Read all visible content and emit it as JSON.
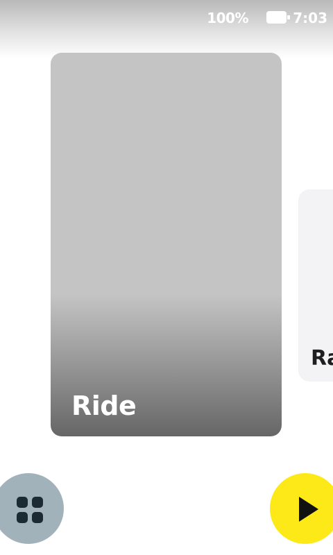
{
  "status_bar": {
    "battery_percent": "100%",
    "battery_icon": "battery-full-icon",
    "time": "7:03"
  },
  "carousel": {
    "cards": [
      {
        "label": "Ride"
      },
      {
        "label": "Ra"
      }
    ]
  },
  "controls": {
    "menu_icon": "grid-icon",
    "play_icon": "play-icon"
  },
  "colors": {
    "menu_button": "#a2b2ba",
    "play_button": "#fde918",
    "card_gray": "#c4c4c4",
    "card_next": "#f3f2f5"
  }
}
